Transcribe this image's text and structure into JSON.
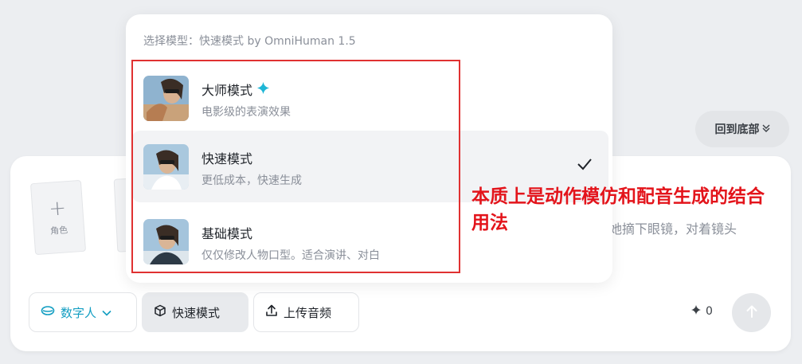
{
  "back_to_bottom": {
    "label": "回到底部",
    "icon": "double-chevron-down-icon"
  },
  "input_panel": {
    "role_card_label": "角色",
    "prompt_visible_text": "她摘下眼镜，对着镜头",
    "buttons": {
      "digital_human": "数字人",
      "mode": "快速模式",
      "upload_audio": "上传音频"
    },
    "credits": "0"
  },
  "dropdown": {
    "title": "选择模型：快速模式 by OmniHuman 1.5",
    "options": [
      {
        "name": "大师模式",
        "desc": "电影级的表演效果",
        "badge_icon": "sparkle-icon",
        "selected": false
      },
      {
        "name": "快速模式",
        "desc": "更低成本，快速生成",
        "selected": true
      },
      {
        "name": "基础模式",
        "desc": "仅仅修改人物口型。适合演讲、对白",
        "selected": false
      }
    ]
  },
  "annotation": {
    "text": "本质上是动作模仿和配音生成的结合用法",
    "color": "#e3141b"
  },
  "colors": {
    "accent": "#139ec2",
    "annotation_red": "#e03131"
  }
}
